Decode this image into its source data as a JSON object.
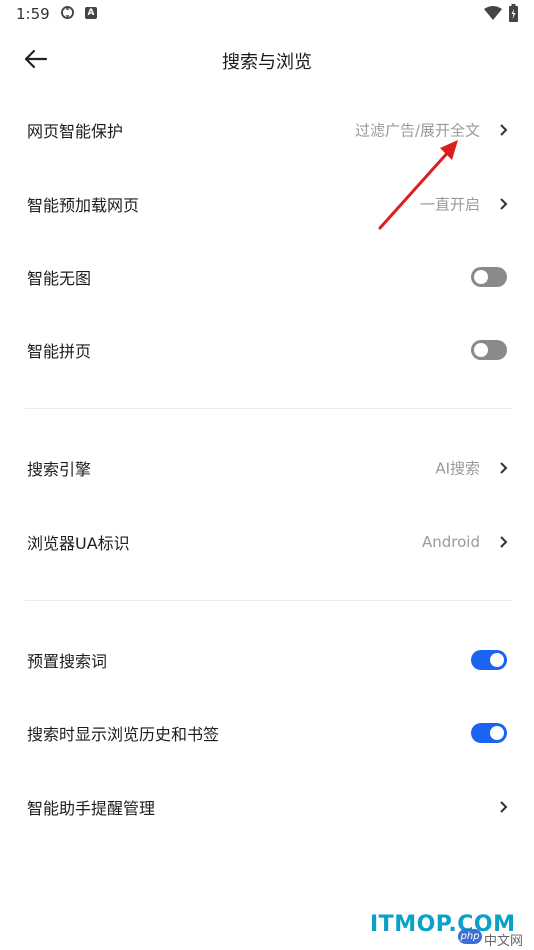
{
  "status_bar": {
    "time": "1:59",
    "icon_b_letter": "A"
  },
  "header": {
    "title": "搜索与浏览"
  },
  "rows": {
    "web_protect": {
      "label": "网页智能保护",
      "value": "过滤广告/展开全文"
    },
    "preload": {
      "label": "智能预加载网页",
      "value": "一直开启"
    },
    "no_image": {
      "label": "智能无图",
      "toggle": "off"
    },
    "page_join": {
      "label": "智能拼页",
      "toggle": "off"
    },
    "search_engine": {
      "label": "搜索引擎",
      "value": "AI搜索"
    },
    "ua": {
      "label": "浏览器UA标识",
      "value": "Android"
    },
    "preset_words": {
      "label": "预置搜索词",
      "toggle": "on"
    },
    "show_history": {
      "label": "搜索时显示浏览历史和书签",
      "toggle": "on"
    },
    "assistant_reminder": {
      "label": "智能助手提醒管理"
    }
  },
  "colors": {
    "accent": "#1a64f2",
    "toggle_off": "#8a8a8a",
    "annotation_arrow": "#d81e1e",
    "watermark": "#0aa0c8"
  },
  "watermark": {
    "text": "ITMOP.COM",
    "badge": "php",
    "sub": "中文网"
  }
}
